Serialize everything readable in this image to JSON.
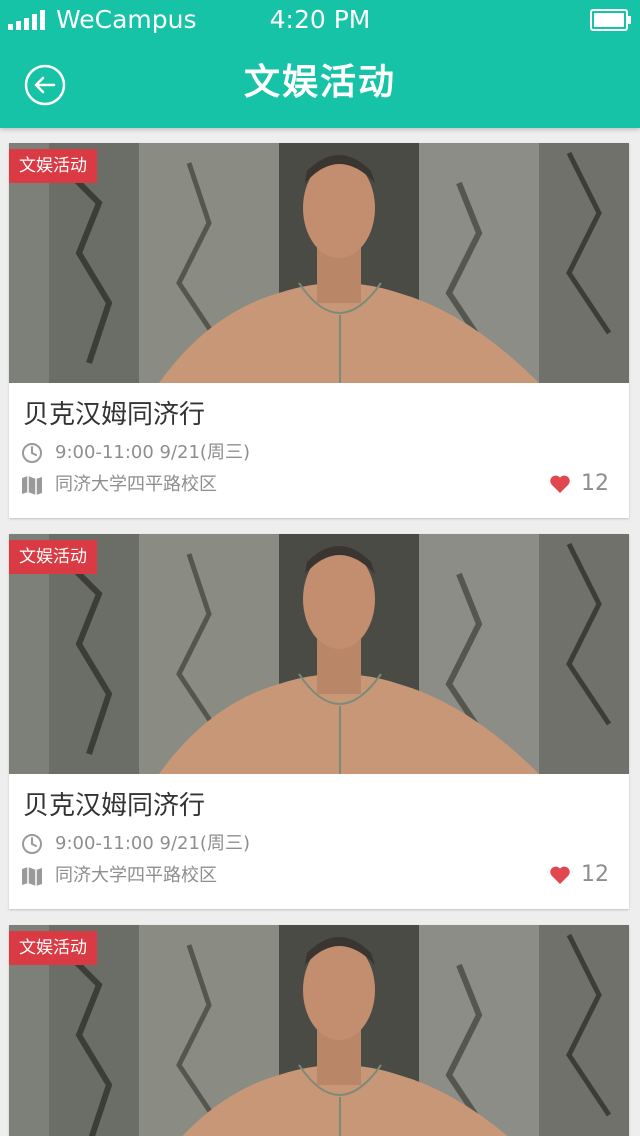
{
  "status_bar": {
    "carrier": "WeCampus",
    "time": "4:20 PM"
  },
  "nav": {
    "title": "文娱活动",
    "back_icon": "back-arrow-circle-icon"
  },
  "theme": {
    "header_color": "#17c3a6",
    "tag_color": "#d93a43",
    "heart_color": "#e0474f",
    "background": "#eeeeee"
  },
  "events": [
    {
      "category": "文娱活动",
      "title": "贝克汉姆同济行",
      "time": "9:00-11:00 9/21(周三)",
      "location": "同济大学四平路校区",
      "likes": "12"
    },
    {
      "category": "文娱活动",
      "title": "贝克汉姆同济行",
      "time": "9:00-11:00 9/21(周三)",
      "location": "同济大学四平路校区",
      "likes": "12"
    },
    {
      "category": "文娱活动",
      "title": "",
      "time": "",
      "location": "",
      "likes": ""
    }
  ]
}
